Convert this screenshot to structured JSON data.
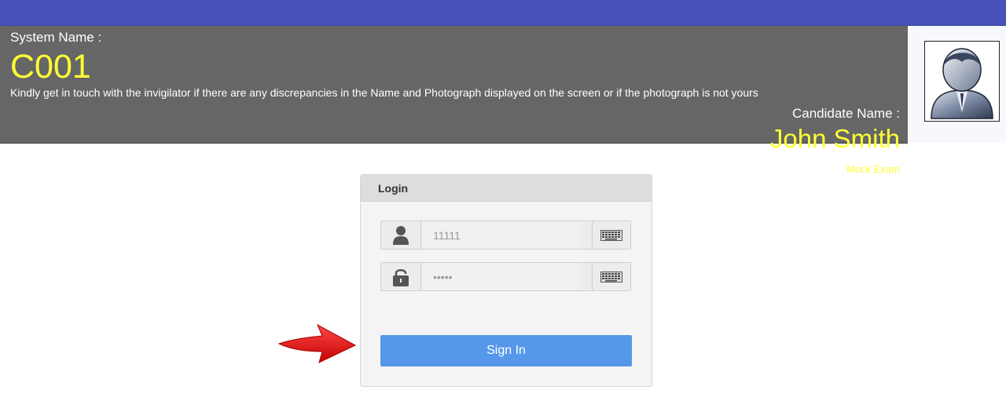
{
  "header": {
    "system_label": "System Name :",
    "system_value": "C001",
    "notice": "Kindly get in touch with the invigilator if there are any discrepancies in the Name and Photograph displayed on the screen or if the photograph is not yours",
    "candidate_label": "Candidate Name :",
    "candidate_name": "John Smith",
    "exam_name": "Mock Exam"
  },
  "login": {
    "title": "Login",
    "username_value": "11111",
    "password_value": "•••••",
    "signin_label": "Sign In"
  },
  "icons": {
    "user": "user-icon",
    "lock": "lock-icon",
    "keyboard": "keyboard-icon",
    "avatar": "avatar-photo",
    "arrow": "red-arrow-pointer"
  },
  "colors": {
    "topbar": "#4752b8",
    "header_bg": "#666666",
    "highlight_text": "#ffff33",
    "signin_button": "#5598ea",
    "arrow": "#ee1111"
  }
}
